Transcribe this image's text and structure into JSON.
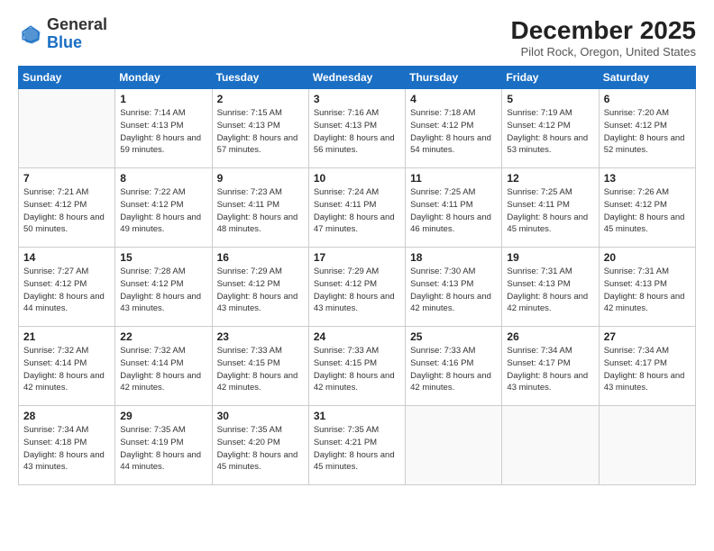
{
  "header": {
    "logo_general": "General",
    "logo_blue": "Blue",
    "month_title": "December 2025",
    "location": "Pilot Rock, Oregon, United States"
  },
  "days_of_week": [
    "Sunday",
    "Monday",
    "Tuesday",
    "Wednesday",
    "Thursday",
    "Friday",
    "Saturday"
  ],
  "weeks": [
    [
      {
        "day": "",
        "info": ""
      },
      {
        "day": "1",
        "info": "Sunrise: 7:14 AM\nSunset: 4:13 PM\nDaylight: 8 hours\nand 59 minutes."
      },
      {
        "day": "2",
        "info": "Sunrise: 7:15 AM\nSunset: 4:13 PM\nDaylight: 8 hours\nand 57 minutes."
      },
      {
        "day": "3",
        "info": "Sunrise: 7:16 AM\nSunset: 4:13 PM\nDaylight: 8 hours\nand 56 minutes."
      },
      {
        "day": "4",
        "info": "Sunrise: 7:18 AM\nSunset: 4:12 PM\nDaylight: 8 hours\nand 54 minutes."
      },
      {
        "day": "5",
        "info": "Sunrise: 7:19 AM\nSunset: 4:12 PM\nDaylight: 8 hours\nand 53 minutes."
      },
      {
        "day": "6",
        "info": "Sunrise: 7:20 AM\nSunset: 4:12 PM\nDaylight: 8 hours\nand 52 minutes."
      }
    ],
    [
      {
        "day": "7",
        "info": "Sunrise: 7:21 AM\nSunset: 4:12 PM\nDaylight: 8 hours\nand 50 minutes."
      },
      {
        "day": "8",
        "info": "Sunrise: 7:22 AM\nSunset: 4:12 PM\nDaylight: 8 hours\nand 49 minutes."
      },
      {
        "day": "9",
        "info": "Sunrise: 7:23 AM\nSunset: 4:11 PM\nDaylight: 8 hours\nand 48 minutes."
      },
      {
        "day": "10",
        "info": "Sunrise: 7:24 AM\nSunset: 4:11 PM\nDaylight: 8 hours\nand 47 minutes."
      },
      {
        "day": "11",
        "info": "Sunrise: 7:25 AM\nSunset: 4:11 PM\nDaylight: 8 hours\nand 46 minutes."
      },
      {
        "day": "12",
        "info": "Sunrise: 7:25 AM\nSunset: 4:11 PM\nDaylight: 8 hours\nand 45 minutes."
      },
      {
        "day": "13",
        "info": "Sunrise: 7:26 AM\nSunset: 4:12 PM\nDaylight: 8 hours\nand 45 minutes."
      }
    ],
    [
      {
        "day": "14",
        "info": "Sunrise: 7:27 AM\nSunset: 4:12 PM\nDaylight: 8 hours\nand 44 minutes."
      },
      {
        "day": "15",
        "info": "Sunrise: 7:28 AM\nSunset: 4:12 PM\nDaylight: 8 hours\nand 43 minutes."
      },
      {
        "day": "16",
        "info": "Sunrise: 7:29 AM\nSunset: 4:12 PM\nDaylight: 8 hours\nand 43 minutes."
      },
      {
        "day": "17",
        "info": "Sunrise: 7:29 AM\nSunset: 4:12 PM\nDaylight: 8 hours\nand 43 minutes."
      },
      {
        "day": "18",
        "info": "Sunrise: 7:30 AM\nSunset: 4:13 PM\nDaylight: 8 hours\nand 42 minutes."
      },
      {
        "day": "19",
        "info": "Sunrise: 7:31 AM\nSunset: 4:13 PM\nDaylight: 8 hours\nand 42 minutes."
      },
      {
        "day": "20",
        "info": "Sunrise: 7:31 AM\nSunset: 4:13 PM\nDaylight: 8 hours\nand 42 minutes."
      }
    ],
    [
      {
        "day": "21",
        "info": "Sunrise: 7:32 AM\nSunset: 4:14 PM\nDaylight: 8 hours\nand 42 minutes."
      },
      {
        "day": "22",
        "info": "Sunrise: 7:32 AM\nSunset: 4:14 PM\nDaylight: 8 hours\nand 42 minutes."
      },
      {
        "day": "23",
        "info": "Sunrise: 7:33 AM\nSunset: 4:15 PM\nDaylight: 8 hours\nand 42 minutes."
      },
      {
        "day": "24",
        "info": "Sunrise: 7:33 AM\nSunset: 4:15 PM\nDaylight: 8 hours\nand 42 minutes."
      },
      {
        "day": "25",
        "info": "Sunrise: 7:33 AM\nSunset: 4:16 PM\nDaylight: 8 hours\nand 42 minutes."
      },
      {
        "day": "26",
        "info": "Sunrise: 7:34 AM\nSunset: 4:17 PM\nDaylight: 8 hours\nand 43 minutes."
      },
      {
        "day": "27",
        "info": "Sunrise: 7:34 AM\nSunset: 4:17 PM\nDaylight: 8 hours\nand 43 minutes."
      }
    ],
    [
      {
        "day": "28",
        "info": "Sunrise: 7:34 AM\nSunset: 4:18 PM\nDaylight: 8 hours\nand 43 minutes."
      },
      {
        "day": "29",
        "info": "Sunrise: 7:35 AM\nSunset: 4:19 PM\nDaylight: 8 hours\nand 44 minutes."
      },
      {
        "day": "30",
        "info": "Sunrise: 7:35 AM\nSunset: 4:20 PM\nDaylight: 8 hours\nand 45 minutes."
      },
      {
        "day": "31",
        "info": "Sunrise: 7:35 AM\nSunset: 4:21 PM\nDaylight: 8 hours\nand 45 minutes."
      },
      {
        "day": "",
        "info": ""
      },
      {
        "day": "",
        "info": ""
      },
      {
        "day": "",
        "info": ""
      }
    ]
  ]
}
